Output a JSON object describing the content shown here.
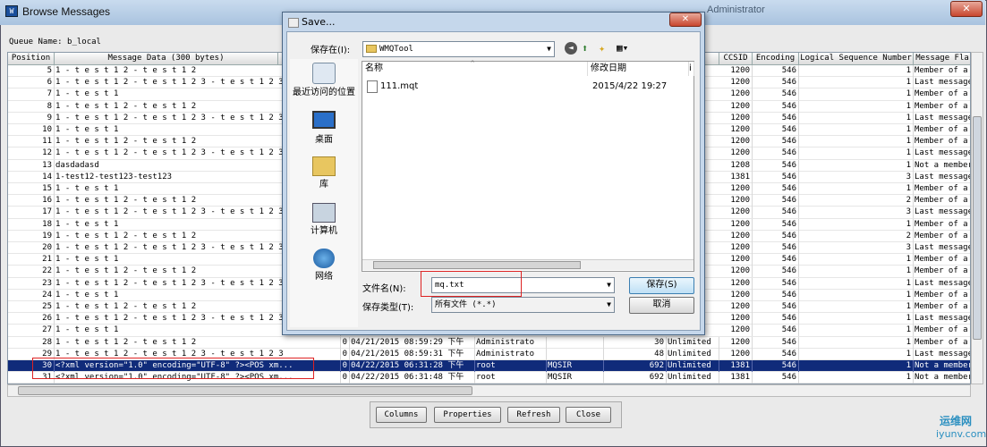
{
  "window": {
    "title": "Browse Messages",
    "title_bg": "Administrator",
    "close": "✕"
  },
  "queue": {
    "label": "Queue Name: b_local"
  },
  "table": {
    "columns": [
      "Position",
      "Message Data (300 bytes)",
      "CCSID",
      "Encoding",
      "Logical Sequence Number",
      "Message Fla"
    ],
    "rows": [
      {
        "pos": "5",
        "data": "1 - t e s t 1 2 - t e s t 1 2",
        "ccsid": "1200",
        "enc": "546",
        "lsn": "1",
        "flag": "Member of a"
      },
      {
        "pos": "6",
        "data": "1 - t e s t 1 2 - t e s t 1 2 3 - t e s t 1 2 3",
        "ccsid": "1200",
        "enc": "546",
        "lsn": "1",
        "flag": "Last message"
      },
      {
        "pos": "7",
        "data": "1 - t e s t 1",
        "ccsid": "1200",
        "enc": "546",
        "lsn": "1",
        "flag": "Member of a"
      },
      {
        "pos": "8",
        "data": "1 - t e s t 1 2 - t e s t 1 2",
        "ccsid": "1200",
        "enc": "546",
        "lsn": "1",
        "flag": "Member of a"
      },
      {
        "pos": "9",
        "data": "1 - t e s t 1 2 - t e s t 1 2 3 - t e s t 1 2 3",
        "ccsid": "1200",
        "enc": "546",
        "lsn": "1",
        "flag": "Last message"
      },
      {
        "pos": "10",
        "data": "1 - t e s t 1",
        "ccsid": "1200",
        "enc": "546",
        "lsn": "1",
        "flag": "Member of a"
      },
      {
        "pos": "11",
        "data": "1 - t e s t 1 2 - t e s t 1 2",
        "ccsid": "1200",
        "enc": "546",
        "lsn": "1",
        "flag": "Member of a"
      },
      {
        "pos": "12",
        "data": "1 - t e s t 1 2 - t e s t 1 2 3 - t e s t 1 2 3",
        "ccsid": "1200",
        "enc": "546",
        "lsn": "1",
        "flag": "Last message"
      },
      {
        "pos": "13",
        "data": "dasdadasd",
        "ccsid": "1208",
        "enc": "546",
        "lsn": "1",
        "flag": "Not a member"
      },
      {
        "pos": "14",
        "data": "1-test12-test123-test123",
        "ccsid": "1381",
        "enc": "546",
        "lsn": "3",
        "flag": "Last message"
      },
      {
        "pos": "15",
        "data": "1 - t e s t 1",
        "ccsid": "1200",
        "enc": "546",
        "lsn": "1",
        "flag": "Member of a"
      },
      {
        "pos": "16",
        "data": "1 - t e s t 1 2 - t e s t 1 2",
        "ccsid": "1200",
        "enc": "546",
        "lsn": "2",
        "flag": "Member of a"
      },
      {
        "pos": "17",
        "data": "1 - t e s t 1 2 - t e s t 1 2 3 - t e s t 1 2 3",
        "ccsid": "1200",
        "enc": "546",
        "lsn": "3",
        "flag": "Last message"
      },
      {
        "pos": "18",
        "data": "1 - t e s t 1",
        "ccsid": "1200",
        "enc": "546",
        "lsn": "1",
        "flag": "Member of a"
      },
      {
        "pos": "19",
        "data": "1 - t e s t 1 2 - t e s t 1 2",
        "ccsid": "1200",
        "enc": "546",
        "lsn": "2",
        "flag": "Member of a"
      },
      {
        "pos": "20",
        "data": "1 - t e s t 1 2 - t e s t 1 2 3 - t e s t 1 2 3",
        "ccsid": "1200",
        "enc": "546",
        "lsn": "3",
        "flag": "Last message"
      },
      {
        "pos": "21",
        "data": "1 - t e s t 1",
        "ccsid": "1200",
        "enc": "546",
        "lsn": "1",
        "flag": "Member of a"
      },
      {
        "pos": "22",
        "data": "1 - t e s t 1 2 - t e s t 1 2",
        "ccsid": "1200",
        "enc": "546",
        "lsn": "1",
        "flag": "Member of a"
      },
      {
        "pos": "23",
        "data": "1 - t e s t 1 2 - t e s t 1 2 3 - t e s t 1 2 3",
        "ccsid": "1200",
        "enc": "546",
        "lsn": "1",
        "flag": "Last message"
      },
      {
        "pos": "24",
        "data": "1 - t e s t 1",
        "ccsid": "1200",
        "enc": "546",
        "lsn": "1",
        "flag": "Member of a"
      },
      {
        "pos": "25",
        "data": "1 - t e s t 1 2 - t e s t 1 2",
        "ccsid": "1200",
        "enc": "546",
        "lsn": "1",
        "flag": "Member of a"
      },
      {
        "pos": "26",
        "data": "1 - t e s t 1 2 - t e s t 1 2 3 - t e s t 1 2 3",
        "ccsid": "1200",
        "enc": "546",
        "lsn": "1",
        "flag": "Last message"
      },
      {
        "pos": "27",
        "data": "1 - t e s t 1",
        "ccsid": "1200",
        "enc": "546",
        "lsn": "1",
        "flag": "Member of a"
      },
      {
        "pos": "28",
        "data": "1 - t e s t 1 2 - t e s t 1 2",
        "zero": "0",
        "date": "04/21/2015 08:59:29 下午",
        "user": "Administrato",
        "put": "",
        "len": "30",
        "exp": "Unlimited",
        "ccsid": "1200",
        "enc": "546",
        "lsn": "1",
        "flag": "Member of a"
      },
      {
        "pos": "29",
        "data": "1 - t e s t 1 2 - t e s t 1 2 3 - t e s t 1 2 3",
        "zero": "0",
        "date": "04/21/2015 08:59:31 下午",
        "user": "Administrato",
        "put": "",
        "len": "48",
        "exp": "Unlimited",
        "ccsid": "1200",
        "enc": "546",
        "lsn": "1",
        "flag": "Last message"
      },
      {
        "pos": "30",
        "data": "<?xml version=\"1.0\" encoding=\"UTF-8\" ?><POS xm...",
        "zero": "0",
        "date": "04/22/2015 06:31:28 下午",
        "user": "root",
        "put": "MQSIR",
        "len": "692",
        "exp": "Unlimited",
        "ccsid": "1381",
        "enc": "546",
        "lsn": "1",
        "flag": "Not a member"
      },
      {
        "pos": "31",
        "data": "<?xml version=\"1.0\" encoding=\"UTF-8\" ?><POS xm...",
        "zero": "0",
        "date": "04/22/2015 06:31:48 下午",
        "user": "root",
        "put": "MQSIR",
        "len": "692",
        "exp": "Unlimited",
        "ccsid": "1381",
        "enc": "546",
        "lsn": "1",
        "flag": "Not a member"
      }
    ]
  },
  "buttons": {
    "columns": "Columns",
    "properties": "Properties",
    "refresh": "Refresh",
    "close": "Close"
  },
  "dialog": {
    "title": "Save...",
    "save_in_label": "保存在(I):",
    "folder": "WMQTool",
    "places": [
      "最近访问的位置",
      "桌面",
      "库",
      "计算机",
      "网络"
    ],
    "col_name": "名称",
    "col_date": "修改日期",
    "col_more": "i",
    "file": {
      "name": "111.mqt",
      "date": "2015/4/22 19:27"
    },
    "filename_label": "文件名(N):",
    "filename_value": "mq.txt",
    "filetype_label": "保存类型(T):",
    "filetype_value": "所有文件 (*.*)",
    "save_btn": "保存(S)",
    "cancel_btn": "取消",
    "close": "✕"
  },
  "watermark": {
    "line1": "运维网",
    "line2": "iyunv.com"
  },
  "colors": {
    "selection": "#102b7a",
    "highlight_box": "#d22222"
  }
}
